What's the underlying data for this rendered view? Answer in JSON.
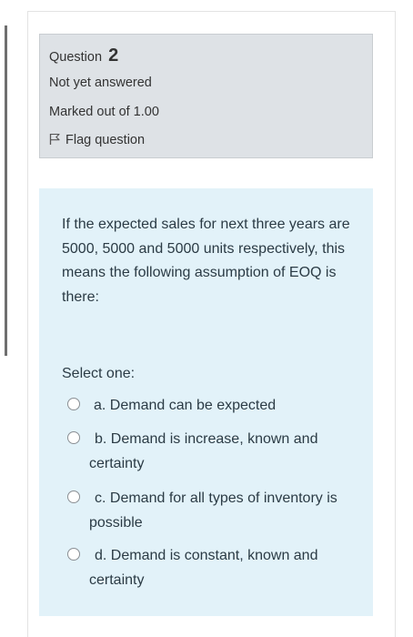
{
  "question": {
    "prefix": "Question",
    "number": "2",
    "state": "Not yet answered",
    "grade": "Marked out of 1.00",
    "flag_label": "Flag question"
  },
  "content": {
    "text": "If the expected sales for next three years are 5000, 5000 and 5000 units respectively, this means the following assumption of EOQ is there:",
    "prompt": "Select one:",
    "options": [
      {
        "label": "a. Demand can be expected"
      },
      {
        "label": "b. Demand is increase, known and certainty"
      },
      {
        "label": "c. Demand for all types of inventory is possible"
      },
      {
        "label": "d. Demand is constant, known and certainty"
      }
    ]
  },
  "colors": {
    "info_bg": "#dee2e6",
    "content_bg": "#e2f2f9",
    "text": "#2b3b45"
  },
  "icons": {
    "flag": "flag-icon",
    "radio": "radio-button"
  }
}
